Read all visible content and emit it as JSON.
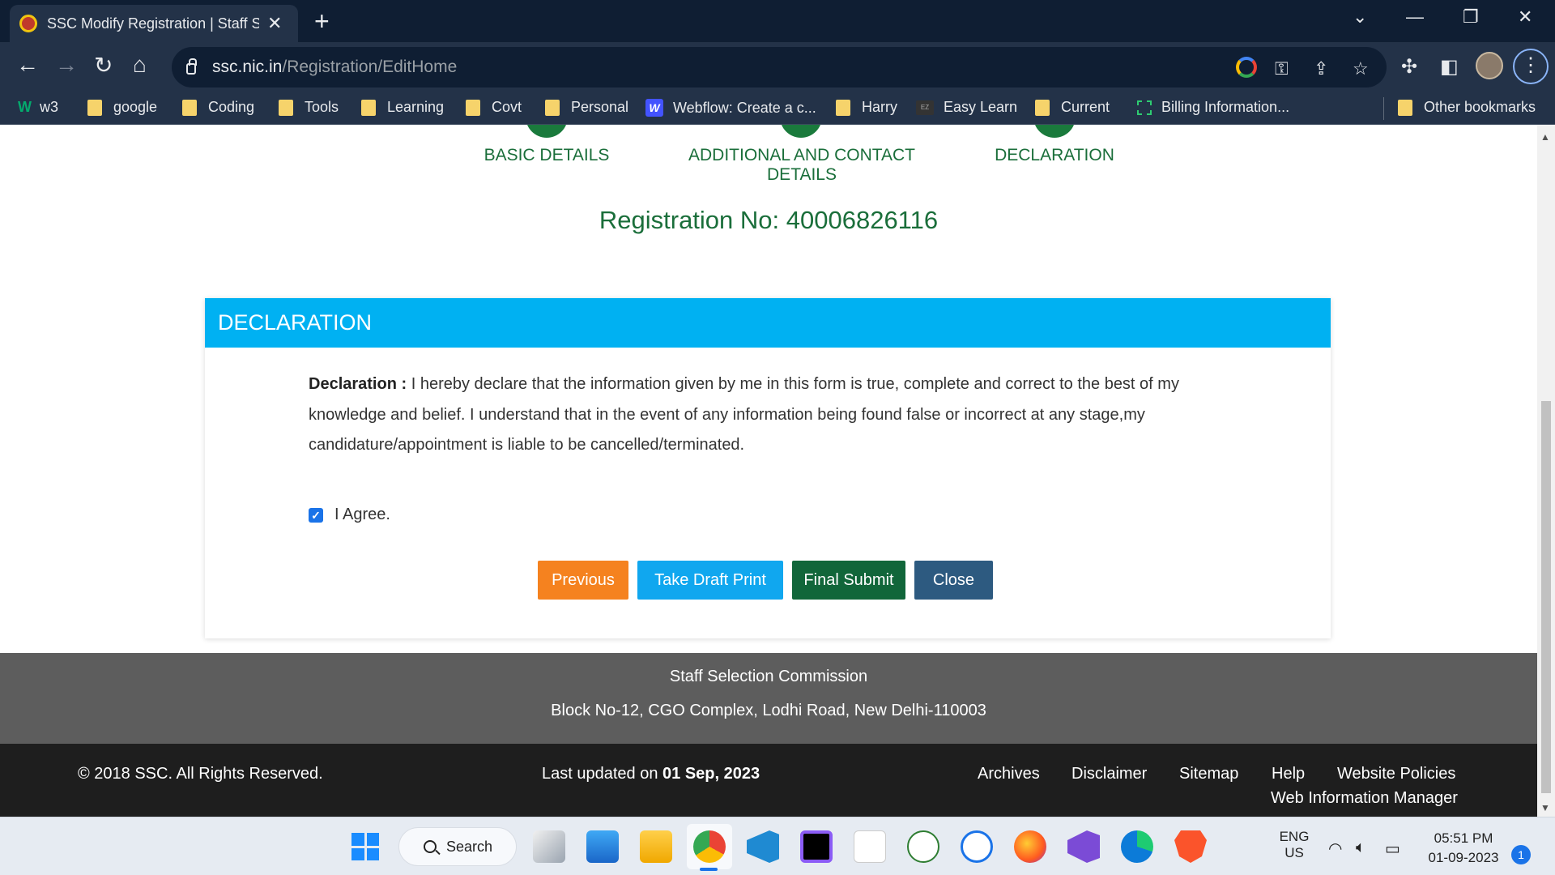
{
  "browser": {
    "tab_title": "SSC Modify Registration | Staff Se",
    "new_tab": "+",
    "url_host": "ssc.nic.in",
    "url_path": "/Registration/EditHome",
    "bookmarks": [
      {
        "label": "w3",
        "icon": "w3-icon"
      },
      {
        "label": "google",
        "icon": "folder-icon"
      },
      {
        "label": "Coding",
        "icon": "folder-icon"
      },
      {
        "label": "Tools",
        "icon": "folder-icon"
      },
      {
        "label": "Learning",
        "icon": "folder-icon"
      },
      {
        "label": "Covt",
        "icon": "folder-icon"
      },
      {
        "label": "Personal",
        "icon": "folder-icon"
      },
      {
        "label": "Webflow: Create a c...",
        "icon": "webflow-icon"
      },
      {
        "label": "Harry",
        "icon": "folder-icon"
      },
      {
        "label": "Easy Learn",
        "icon": "easylearn-icon"
      },
      {
        "label": "Current",
        "icon": "folder-icon"
      },
      {
        "label": "Billing Information...",
        "icon": "billing-icon"
      },
      {
        "label": "Other bookmarks",
        "icon": "folder-icon"
      }
    ]
  },
  "steps": [
    {
      "label": "BASIC DETAILS"
    },
    {
      "label": "ADDITIONAL AND CONTACT DETAILS"
    },
    {
      "label": "DECLARATION"
    }
  ],
  "registration": {
    "text": "Registration No: 40006826116"
  },
  "declaration": {
    "heading": "DECLARATION",
    "label": "Declaration :",
    "text": " I hereby declare that the information given by me in this form is true, complete and correct to the best of my knowledge and belief. I understand that in the event of any information being found false or incorrect at any stage,my candidature/appointment is liable to be cancelled/terminated.",
    "agree_label": "I Agree.",
    "agree_checked": true
  },
  "buttons": {
    "previous": "Previous",
    "draft_print": "Take Draft Print",
    "final_submit": "Final Submit",
    "close": "Close"
  },
  "footer": {
    "org_name": "Staff Selection Commission",
    "address": "Block No-12, CGO Complex, Lodhi Road, New Delhi-110003",
    "copyright": "© 2018 SSC. All Rights Reserved.",
    "last_updated_prefix": "Last updated on ",
    "last_updated_date": "01 Sep, 2023",
    "links": {
      "archives": "Archives",
      "disclaimer": "Disclaimer",
      "sitemap": "Sitemap",
      "help": "Help",
      "website_policies": "Website Policies",
      "web_info_manager": "Web Information Manager"
    }
  },
  "taskbar": {
    "search_label": "Search",
    "lang_line1": "ENG",
    "lang_line2": "US",
    "time": "05:51 PM",
    "date": "01-09-2023",
    "notification_count": "1"
  },
  "colors": {
    "header_blue": "#00b1f2",
    "green": "#1a6e3a",
    "btn_previous": "#f5821f",
    "btn_draft": "#10a7ef",
    "btn_final": "#11663a",
    "btn_close": "#2d5a80"
  }
}
